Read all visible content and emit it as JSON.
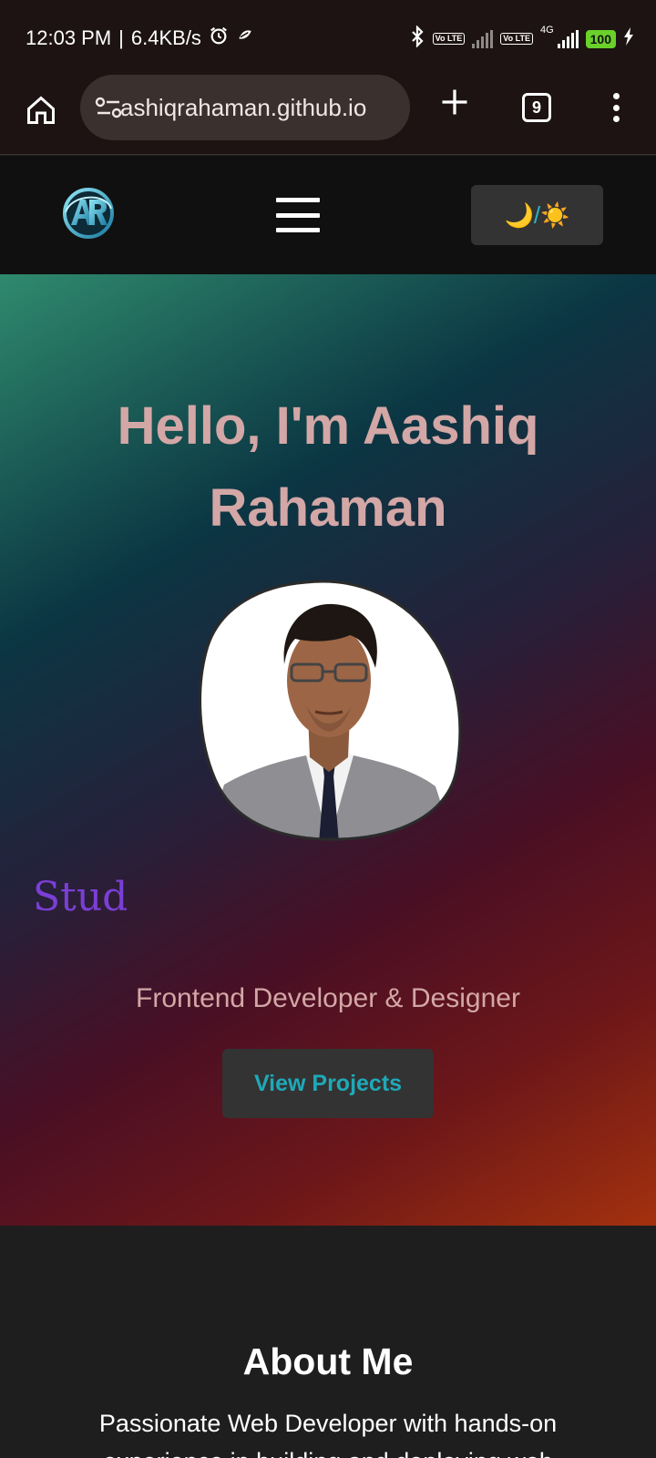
{
  "status_bar": {
    "time": "12:03 PM",
    "separator": "|",
    "net_speed": "6.4KB/s",
    "volte_1": "Vo LTE",
    "volte_2": "Vo LTE",
    "network_type": "4G",
    "battery": "100"
  },
  "browser": {
    "url": "ashiqrahaman.github.io",
    "tab_count": "9"
  },
  "nav": {
    "theme_toggle_label": "🌙/☀️"
  },
  "hero": {
    "title": "Hello, I'm Aashiq Rahaman",
    "typed_text": "Stud",
    "subtitle": "Frontend Developer & Designer",
    "cta_label": "View Projects"
  },
  "about": {
    "title": "About Me",
    "text": "Passionate Web Developer with hands-on experience in building and deploying web"
  },
  "colors": {
    "title_pink": "#d3a7a6",
    "typed_purple": "#7a3fd6",
    "cta_teal": "#1fa9b8",
    "nav_bg": "#101010"
  },
  "icons": {
    "logo": "ar-logo-icon",
    "menu": "hamburger-icon",
    "home": "home-icon",
    "site_settings": "site-settings-icon",
    "new_tab": "plus-icon",
    "tabs": "tabs-count-icon",
    "overflow": "more-vert-icon"
  }
}
